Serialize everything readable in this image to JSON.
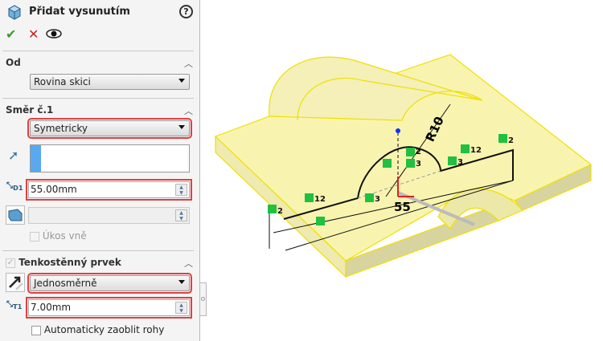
{
  "panel": {
    "title": "Přidat vysunutím",
    "icons": {
      "ok": "checkmark-icon",
      "cancel": "close-icon",
      "preview": "eye-icon",
      "help": "help-icon"
    },
    "od": {
      "label": "Od",
      "value": "Rovina skici"
    },
    "smer": {
      "label": "Směr č.1",
      "end_condition": "Symetricky",
      "selection": "",
      "depth": "55.00mm",
      "draft_value": "",
      "draft_outward": "Úkos vně"
    },
    "thin": {
      "label": "Tenkostěnný prvek",
      "checked": true,
      "type": "Jednosměrně",
      "thickness": "7.00mm",
      "auto_fillet": "Automaticky zaoblit rohy",
      "auto_fillet_checked": false
    },
    "highlight_color": "#e04040"
  },
  "viewport": {
    "dimension_radius": "R10",
    "dimension_length": "55",
    "relations": [
      "2",
      "12",
      "3",
      "2",
      "3",
      "12",
      "3",
      "2"
    ],
    "model_color": "#f8f4b0"
  }
}
